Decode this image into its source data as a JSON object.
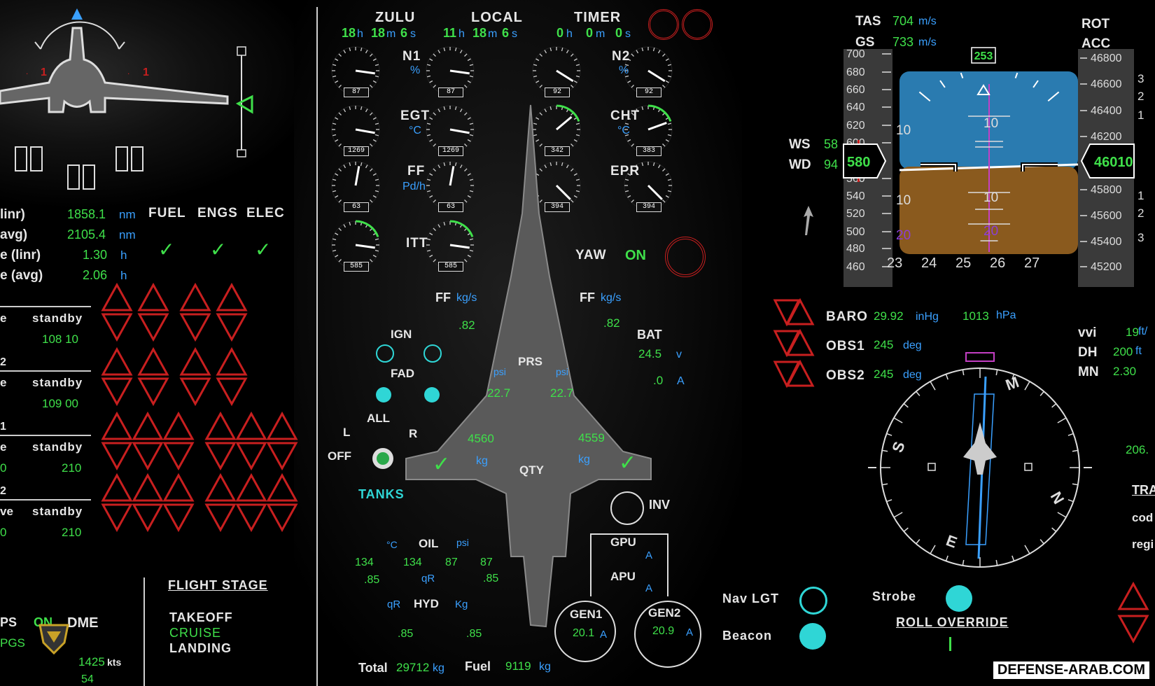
{
  "clock": {
    "zulu_label": "ZULU",
    "local_label": "LOCAL",
    "timer_label": "TIMER",
    "zulu": {
      "h": "18",
      "m": "18",
      "s": "6"
    },
    "local": {
      "h": "11",
      "m": "18",
      "s": "6"
    },
    "timer": {
      "h": "0",
      "m": "0",
      "s": "0"
    },
    "h": "h",
    "m": "m",
    "s": "s"
  },
  "engines": {
    "n1_label": "N1",
    "n1_unit": "%",
    "n2_label": "N2",
    "n2_unit": "%",
    "egt_label": "EGT",
    "egt_unit": "°C",
    "cht_label": "CHT",
    "cht_unit": "°C",
    "ff_label": "FF",
    "ff_unit": "Pd/h",
    "epr_label": "EPR",
    "itt_label": "ITT",
    "n1_values": [
      "87",
      "87"
    ],
    "n2_values": [
      "92",
      "92"
    ],
    "egt_values": [
      "1269",
      "1269"
    ],
    "cht_values": [
      "342",
      "383"
    ],
    "ff_values": [
      "63",
      "63"
    ],
    "epr_values": [
      "394",
      "394"
    ],
    "itt_values": [
      "585",
      "585"
    ],
    "yaw_label": "YAW",
    "yaw_state": "ON"
  },
  "fuel_panel": {
    "ff_label": "FF",
    "ff_unit": "kg/s",
    "ff_left": ".82",
    "ff_right": ".82",
    "ign_label": "IGN",
    "fad_label": "FAD",
    "all_label": "ALL",
    "l_label": "L",
    "r_label": "R",
    "off_label": "OFF",
    "tanks_label": "TANKS",
    "prs_label": "PRS",
    "psi": "psi",
    "prs_left": "22.7",
    "prs_right": "22.7",
    "qty_label": "QTY",
    "kg": "kg",
    "qty_left": "4560",
    "qty_right": "4559",
    "bat_label": "BAT",
    "bat_v": "24.5",
    "v": "v",
    "bat_a": ".0",
    "a": "A",
    "inv_label": "INV",
    "gpu_label": "GPU",
    "apu_label": "APU",
    "gen1_label": "GEN1",
    "gen2_label": "GEN2",
    "gen1_val": "20.1",
    "gen2_val": "20.9",
    "oil_label": "OIL",
    "c_unit": "°C",
    "oil_vals": [
      "134",
      "134",
      "87",
      "87"
    ],
    "qr": "qR",
    "qr_vals": [
      ".85",
      ".85"
    ],
    "hyd_label": "HYD",
    "hyd_kg": "Kg",
    "hyd_vals": [
      ".85",
      ".85"
    ],
    "total_label": "Total",
    "total_val": "29712",
    "fuel_label": "Fuel",
    "fuel_val": "9119"
  },
  "left": {
    "rows": [
      {
        "label": "linr)",
        "val": "1858.1",
        "unit": "nm"
      },
      {
        "label": "avg)",
        "val": "2105.4",
        "unit": "nm"
      },
      {
        "label": "e (linr)",
        "val": "1.30",
        "unit": "h"
      },
      {
        "label": "e (avg)",
        "val": "2.06",
        "unit": "h"
      }
    ],
    "tabs": [
      "FUEL",
      "ENGS",
      "ELEC"
    ],
    "navs": [
      {
        "a": "e",
        "b": "standby",
        "v": "108 10"
      },
      {
        "a": "e",
        "b": "standby",
        "v": "109 00",
        "pre": "2"
      },
      {
        "a": "e",
        "b": "standby",
        "v": "210",
        "pre": "1",
        "z": "0"
      },
      {
        "a": "ve",
        "b": "standby",
        "v": "210",
        "pre": "2",
        "z": "0"
      }
    ],
    "flight_stage_label": "FLIGHT STAGE",
    "stages": [
      "TAKEOFF",
      "CRUISE",
      "LANDING"
    ],
    "ps": "PS",
    "on": "ON",
    "dme": "DME",
    "pgs": "PGS",
    "kts": "kts",
    "dme_val": "1425",
    "gs_val": "54"
  },
  "pfd": {
    "tas_label": "TAS",
    "tas": "704",
    "gs_label": "GS",
    "gs": "733",
    "ms": "m/s",
    "ws_label": "WS",
    "ws": "58",
    "wd_label": "WD",
    "wd": "94",
    "speed_bug": "253",
    "speed": "580",
    "speed_ticks": [
      "700",
      "680",
      "660",
      "640",
      "620",
      "600",
      "560",
      "540",
      "520",
      "500",
      "480",
      "460"
    ],
    "alt": "46010",
    "alt_ticks": [
      "46800",
      "46600",
      "46400",
      "46200",
      "46000",
      "45800",
      "45600",
      "45400",
      "45200"
    ],
    "heading_ticks": [
      "23",
      "24",
      "25",
      "26",
      "27"
    ],
    "pitch": [
      "10",
      "10",
      "10",
      "10",
      "20",
      "20"
    ],
    "rot_label": "ROT",
    "acc_label": "ACC",
    "vs_marks": [
      "3",
      "2",
      "1",
      "1",
      "2",
      "3"
    ]
  },
  "nav": {
    "baro_label": "BARO",
    "baro": "29.92",
    "inhg": "inHg",
    "hpa_val": "1013",
    "hpa": "hPa",
    "obs1_label": "OBS1",
    "obs1": "245",
    "obs2_label": "OBS2",
    "obs2": "245",
    "deg": "deg",
    "vvi_label": "vvi",
    "vvi": "19",
    "ftm": "ft/",
    "dh_label": "DH",
    "dh": "200",
    "ft": "ft",
    "mn_label": "MN",
    "mn": "2.30",
    "compass": [
      "M",
      "S",
      "N",
      "E"
    ],
    "side_val": "206.",
    "tra": "TRA",
    "cod": "cod",
    "reg": "regi"
  },
  "lights": {
    "nav_label": "Nav LGT",
    "beacon_label": "Beacon",
    "strobe_label": "Strobe",
    "roll_override": "ROLL OVERRIDE"
  },
  "watermark": "DEFENSE-ARAB.COM",
  "colors": {
    "green": "#3fe04a",
    "blue": "#3aa0ff",
    "cyan": "#2fd6d6",
    "red": "#c81f1f",
    "sky": "#2a7bb0",
    "ground": "#8a5a1e"
  }
}
